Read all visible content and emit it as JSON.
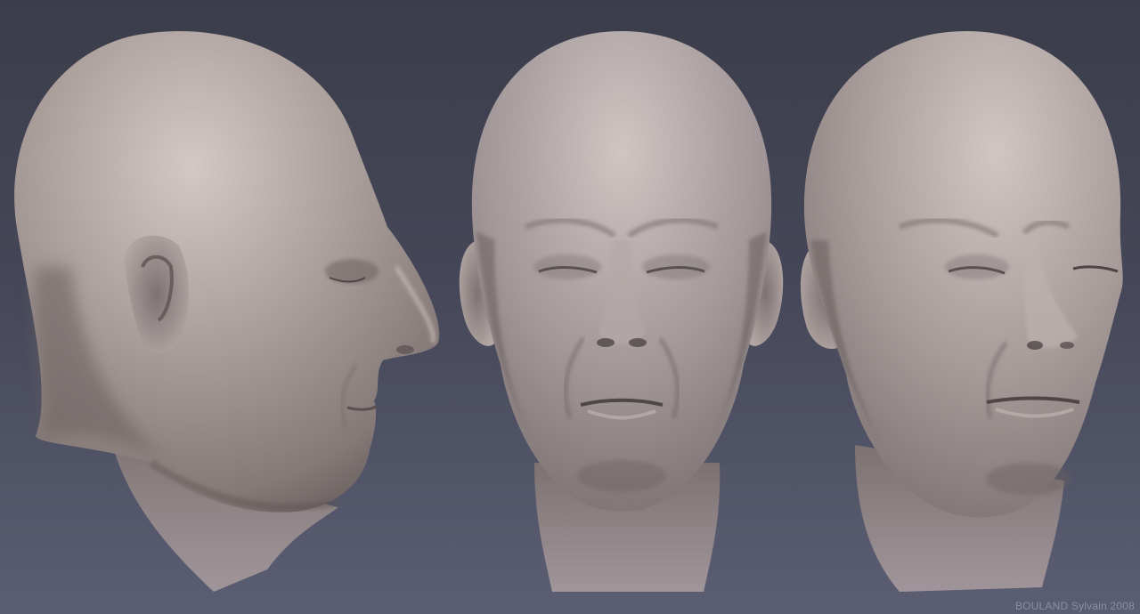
{
  "image": {
    "subject": "three views of a sculpted bald male head",
    "views": [
      "profile-right",
      "front",
      "three-quarter"
    ],
    "signature": "BOULAND Sylvain 2008",
    "colors": {
      "background_top": "#3b3d4a",
      "background_bottom": "#5b5e73",
      "skin_light": "#c7bcb9",
      "skin_mid": "#9f928f",
      "skin_shadow": "#6f6462",
      "signature_text": "#8b8ea3"
    }
  }
}
